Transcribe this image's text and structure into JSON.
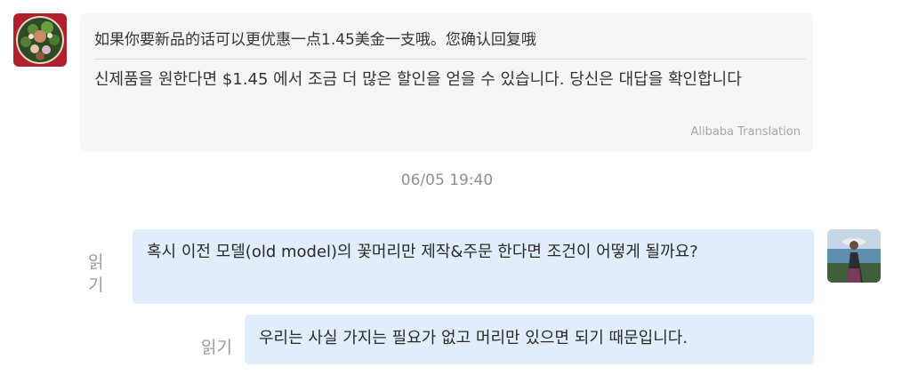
{
  "conversation": {
    "incoming": {
      "original": "如果你要新品的话可以更优惠一点1.45美金一支哦。您确认回复哦",
      "translation": "신제품을 원한다면 $1.45 에서 조금 더 많은 할인을 얻을 수 있습니다. 당신은 대답을 확인합니다",
      "translation_source": "Alibaba Translation"
    },
    "timestamp": "06/05 19:40",
    "outgoing": [
      {
        "text": "혹시 이전 모델(old model)의 꽃머리만 제작&주문 한다면 조건이 어떻게 될까요?",
        "read_status": "읽기"
      },
      {
        "text": "우리는 사실 가지는 필요가 없고 머리만 있으면 되기 때문입니다.",
        "read_status": "읽기"
      }
    ]
  },
  "colors": {
    "incoming_bubble": "#f6f6f6",
    "outgoing_bubble": "#e1edfb",
    "muted_text": "#9a9a9a"
  },
  "icons": {
    "left_avatar": "contact-avatar-flower-wreath",
    "right_avatar": "user-avatar-photo"
  }
}
